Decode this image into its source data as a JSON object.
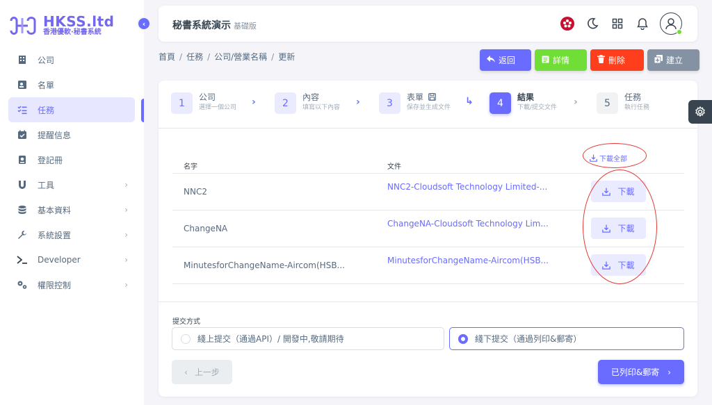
{
  "brand": {
    "title": "HKSS.ltd",
    "subtitle": "香港優軟·秘書系統"
  },
  "sidebar": {
    "items": [
      {
        "label": "公司",
        "icon": "building-icon",
        "has_children": false
      },
      {
        "label": "名單",
        "icon": "contact-card-icon",
        "has_children": false
      },
      {
        "label": "任務",
        "icon": "task-list-icon",
        "has_children": false,
        "active": true
      },
      {
        "label": "提醒信息",
        "icon": "calendar-check-icon",
        "has_children": false
      },
      {
        "label": "登記冊",
        "icon": "register-book-icon",
        "has_children": false
      },
      {
        "label": "工具",
        "icon": "magnet-icon",
        "has_children": true
      },
      {
        "label": "基本資料",
        "icon": "database-icon",
        "has_children": true
      },
      {
        "label": "系統設置",
        "icon": "wrench-icon",
        "has_children": true
      },
      {
        "label": "Developer",
        "icon": "terminal-icon",
        "has_children": true
      },
      {
        "label": "權限控制",
        "icon": "cogs-icon",
        "has_children": true
      }
    ]
  },
  "navbar": {
    "title": "秘書系統演示",
    "edition": "基礎版"
  },
  "breadcrumb": [
    "首頁",
    "任務",
    "公司/營業名稱",
    "更新"
  ],
  "actions": {
    "back": "返回",
    "detail": "詳情",
    "delete": "刪除",
    "create": "建立"
  },
  "colors": {
    "primary": "#696cff",
    "success": "#71dd37",
    "danger": "#ff3e1d",
    "secondary": "#8592a3"
  },
  "stepper": [
    {
      "num": "1",
      "title": "公司",
      "sub": "選擇一個公司"
    },
    {
      "num": "2",
      "title": "內容",
      "sub": "填寫以下內容"
    },
    {
      "num": "3",
      "title": "表單",
      "sub": "保存並生成文件"
    },
    {
      "num": "4",
      "title": "結果",
      "sub": "下載/提交文件"
    },
    {
      "num": "5",
      "title": "任務",
      "sub": "執行任務"
    }
  ],
  "table": {
    "headers": {
      "name": "名字",
      "file": "文件"
    },
    "download_all": "下載全部",
    "rows": [
      {
        "name": "NNC2",
        "file": "NNC2-Cloudsoft Technology Limited-...",
        "action": "下載"
      },
      {
        "name": "ChangeNA",
        "file": "ChangeNA-Cloudsoft Technology Lim...",
        "action": "下載"
      },
      {
        "name": "MinutesforChangeName-Aircom(HSB...",
        "file": "MinutesforChangeName-Aircom(HSB...",
        "action": "下載"
      }
    ]
  },
  "submit": {
    "label": "提交方式",
    "options": [
      {
        "label": "綫上提交（通過API）/ 開發中,敬請期待",
        "selected": false
      },
      {
        "label": "綫下提交（通過列印&郵寄）",
        "selected": true
      }
    ]
  },
  "nav_buttons": {
    "prev": "上一步",
    "next": "已列印&郵寄"
  }
}
